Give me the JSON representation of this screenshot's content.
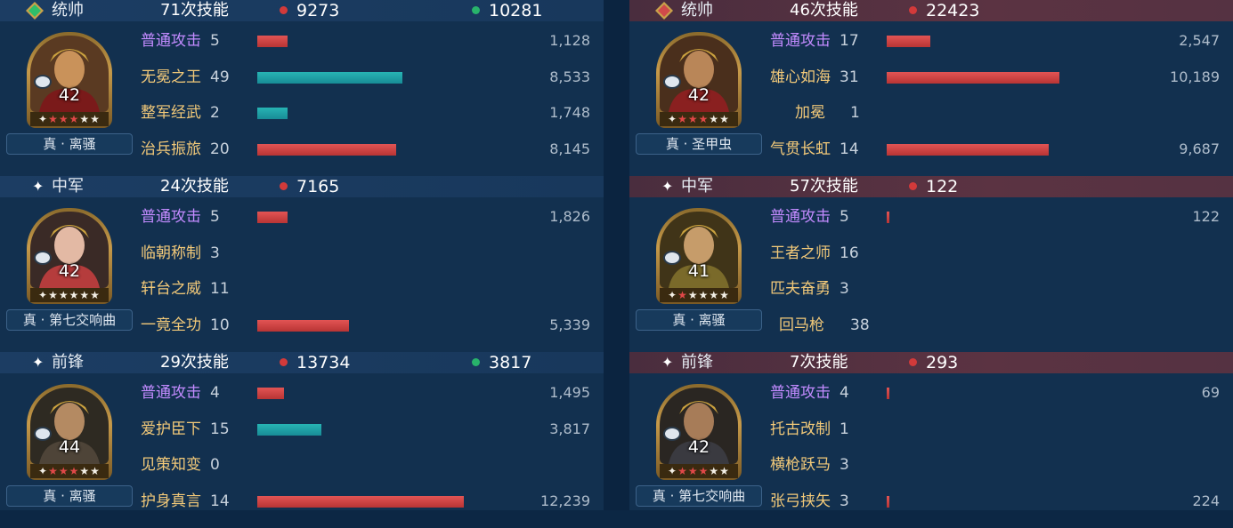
{
  "colors": {
    "damage_bar": "#d94848",
    "heal_bar": "#21a5ab",
    "basic_attack": "#c38bff",
    "skill": "#f2c979"
  },
  "left": {
    "sections": [
      {
        "role": "统帅",
        "role_icon": "green-diamond-icon",
        "casts": "71次技能",
        "damage": "9273",
        "heal": "10281",
        "level": "42",
        "red_stars": 3,
        "total_stars": 5,
        "tag": "真 · 离骚",
        "skills": [
          {
            "name": "普通攻击",
            "count": "5",
            "value": "1,128",
            "type": "damage",
            "fill": 0.09
          },
          {
            "name": "无冕之王",
            "count": "49",
            "value": "8,533",
            "type": "heal",
            "fill": 0.43
          },
          {
            "name": "整军经武",
            "count": "2",
            "value": "1,748",
            "type": "heal",
            "fill": 0.09
          },
          {
            "name": "治兵振旅",
            "count": "20",
            "value": "8,145",
            "type": "damage",
            "fill": 0.41
          }
        ]
      },
      {
        "role": "中军",
        "role_icon": "sparkle-icon",
        "casts": "24次技能",
        "damage": "7165",
        "heal": "",
        "level": "42",
        "red_stars": 0,
        "total_stars": 5,
        "tag": "真 · 第七交响曲",
        "skills": [
          {
            "name": "普通攻击",
            "count": "5",
            "value": "1,826",
            "type": "damage",
            "fill": 0.09
          },
          {
            "name": "临朝称制",
            "count": "3",
            "value": "",
            "type": "none",
            "fill": 0
          },
          {
            "name": "轩台之威",
            "count": "11",
            "value": "",
            "type": "none",
            "fill": 0
          },
          {
            "name": "一竟全功",
            "count": "10",
            "value": "5,339",
            "type": "damage",
            "fill": 0.27
          }
        ]
      },
      {
        "role": "前锋",
        "role_icon": "sparkle-icon",
        "casts": "29次技能",
        "damage": "13734",
        "heal": "3817",
        "level": "44",
        "red_stars": 3,
        "total_stars": 5,
        "tag": "真 · 离骚",
        "skills": [
          {
            "name": "普通攻击",
            "count": "4",
            "value": "1,495",
            "type": "damage",
            "fill": 0.08
          },
          {
            "name": "爱护臣下",
            "count": "15",
            "value": "3,817",
            "type": "heal",
            "fill": 0.19
          },
          {
            "name": "见策知变",
            "count": "0",
            "value": "",
            "type": "none",
            "fill": 0
          },
          {
            "name": "护身真言",
            "count": "14",
            "value": "12,239",
            "type": "damage",
            "fill": 0.61
          }
        ]
      }
    ]
  },
  "right": {
    "sections": [
      {
        "role": "统帅",
        "role_icon": "red-diamond-icon",
        "casts": "46次技能",
        "damage": "22423",
        "heal": "",
        "level": "42",
        "red_stars": 3,
        "total_stars": 5,
        "tag": "真 · 圣甲虫",
        "skills": [
          {
            "name": "普通攻击",
            "count": "17",
            "value": "2,547",
            "type": "damage",
            "fill": 0.13
          },
          {
            "name": "雄心如海",
            "count": "31",
            "value": "10,189",
            "type": "damage",
            "fill": 0.51
          },
          {
            "name": "加冕",
            "count": "1",
            "value": "",
            "type": "none",
            "fill": 0
          },
          {
            "name": "气贯长虹",
            "count": "14",
            "value": "9,687",
            "type": "damage",
            "fill": 0.48
          }
        ]
      },
      {
        "role": "中军",
        "role_icon": "sparkle-icon",
        "casts": "57次技能",
        "damage": "122",
        "heal": "",
        "level": "41",
        "red_stars": 1,
        "total_stars": 5,
        "tag": "真 · 离骚",
        "skills": [
          {
            "name": "普通攻击",
            "count": "5",
            "value": "122",
            "type": "damage",
            "fill": 0.006
          },
          {
            "name": "王者之师",
            "count": "16",
            "value": "",
            "type": "none",
            "fill": 0
          },
          {
            "name": "匹夫奋勇",
            "count": "3",
            "value": "",
            "type": "none",
            "fill": 0
          },
          {
            "name": "回马枪",
            "count": "38",
            "value": "",
            "type": "none",
            "fill": 0
          }
        ]
      },
      {
        "role": "前锋",
        "role_icon": "sparkle-icon",
        "casts": "7次技能",
        "damage": "293",
        "heal": "",
        "level": "42",
        "red_stars": 3,
        "total_stars": 5,
        "tag": "真 · 第七交响曲",
        "skills": [
          {
            "name": "普通攻击",
            "count": "4",
            "value": "69",
            "type": "damage",
            "fill": 0.006
          },
          {
            "name": "托古改制",
            "count": "1",
            "value": "",
            "type": "none",
            "fill": 0
          },
          {
            "name": "横枪跃马",
            "count": "3",
            "value": "",
            "type": "none",
            "fill": 0
          },
          {
            "name": "张弓挟矢",
            "count": "3",
            "value": "224",
            "type": "damage",
            "fill": 0.006
          }
        ]
      }
    ]
  }
}
